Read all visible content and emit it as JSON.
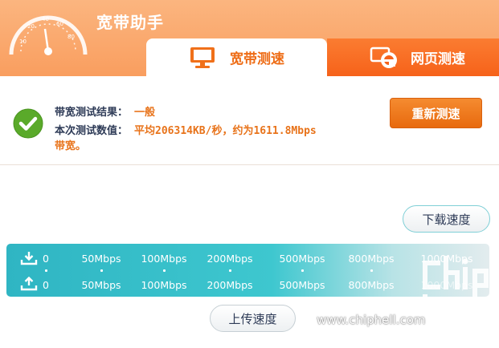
{
  "app": {
    "title": "宽带助手"
  },
  "tabs": [
    {
      "label": "宽带测速",
      "icon": "monitor-icon",
      "active": true
    },
    {
      "label": "网页测速",
      "icon": "internet-explorer-icon",
      "active": false
    }
  ],
  "result": {
    "line1_label": "带宽测试结果：",
    "line1_value": "一般",
    "line2_label": "本次测试数值：",
    "line2_value": "平均206314KB/秒，约为1611.8Mbps",
    "line3_value": "带宽。",
    "retest_button": "重新测速"
  },
  "speedbar": {
    "download_ticks": [
      "0",
      "50Mbps",
      "100Mbps",
      "200Mbps",
      "500Mbps",
      "800Mbps",
      "1000Mbps"
    ],
    "upload_ticks": [
      "0",
      "50Mbps",
      "100Mbps",
      "200Mbps",
      "500Mbps",
      "800Mbps",
      "1000Mbps"
    ],
    "download_label": "下载速度",
    "upload_label": "上传速度"
  },
  "watermark": {
    "text": "www.chiphell.com"
  },
  "colors": {
    "accent": "#f99e5f",
    "tab_orange": "#f6621a",
    "button": "#e86a0e",
    "teal": "#2fb5c3",
    "success": "#5aaa2a"
  }
}
